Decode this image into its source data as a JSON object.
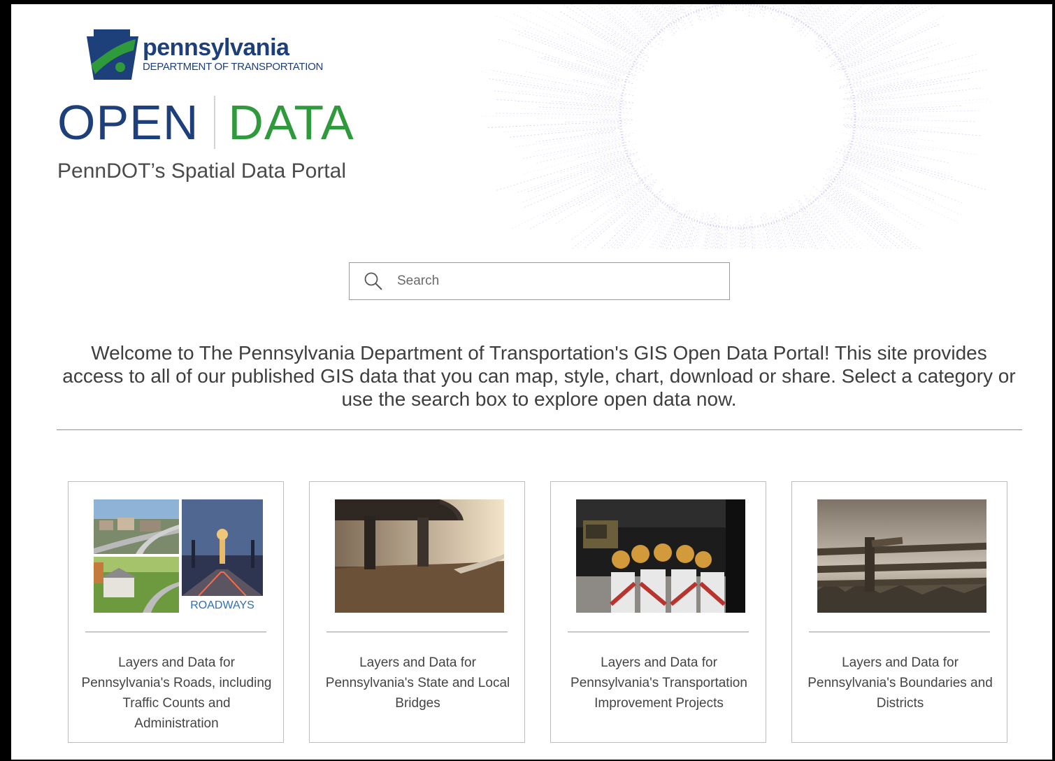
{
  "header": {
    "logo_name": "pennsylvania",
    "logo_dept": "DEPARTMENT OF TRANSPORTATION",
    "open_word": "OPEN",
    "data_word": "DATA",
    "subtitle": "PennDOT’s Spatial Data Portal"
  },
  "search": {
    "placeholder": "Search"
  },
  "welcome": {
    "text": "Welcome to The Pennsylvania Department of Transportation's GIS Open Data Portal! This site provides access to all of our published GIS data that you can map, style, chart, download or share. Select a category or use the search box to explore open data now."
  },
  "categories": [
    {
      "image_caption": "ROADWAYS",
      "label": "Layers and Data for Pennsylvania's Roads, including Traffic Counts and Administration"
    },
    {
      "label": "Layers and Data for Pennsylvania's State and Local Bridges"
    },
    {
      "label": "Layers and Data for Pennsylvania's Transportation Improvement Projects"
    },
    {
      "label": "Layers and Data for Pennsylvania's Boundaries and Districts"
    }
  ],
  "colors": {
    "brand_blue": "#1d3f7a",
    "brand_green": "#2f9a3c",
    "radial_purple": "#9a8ee0"
  }
}
